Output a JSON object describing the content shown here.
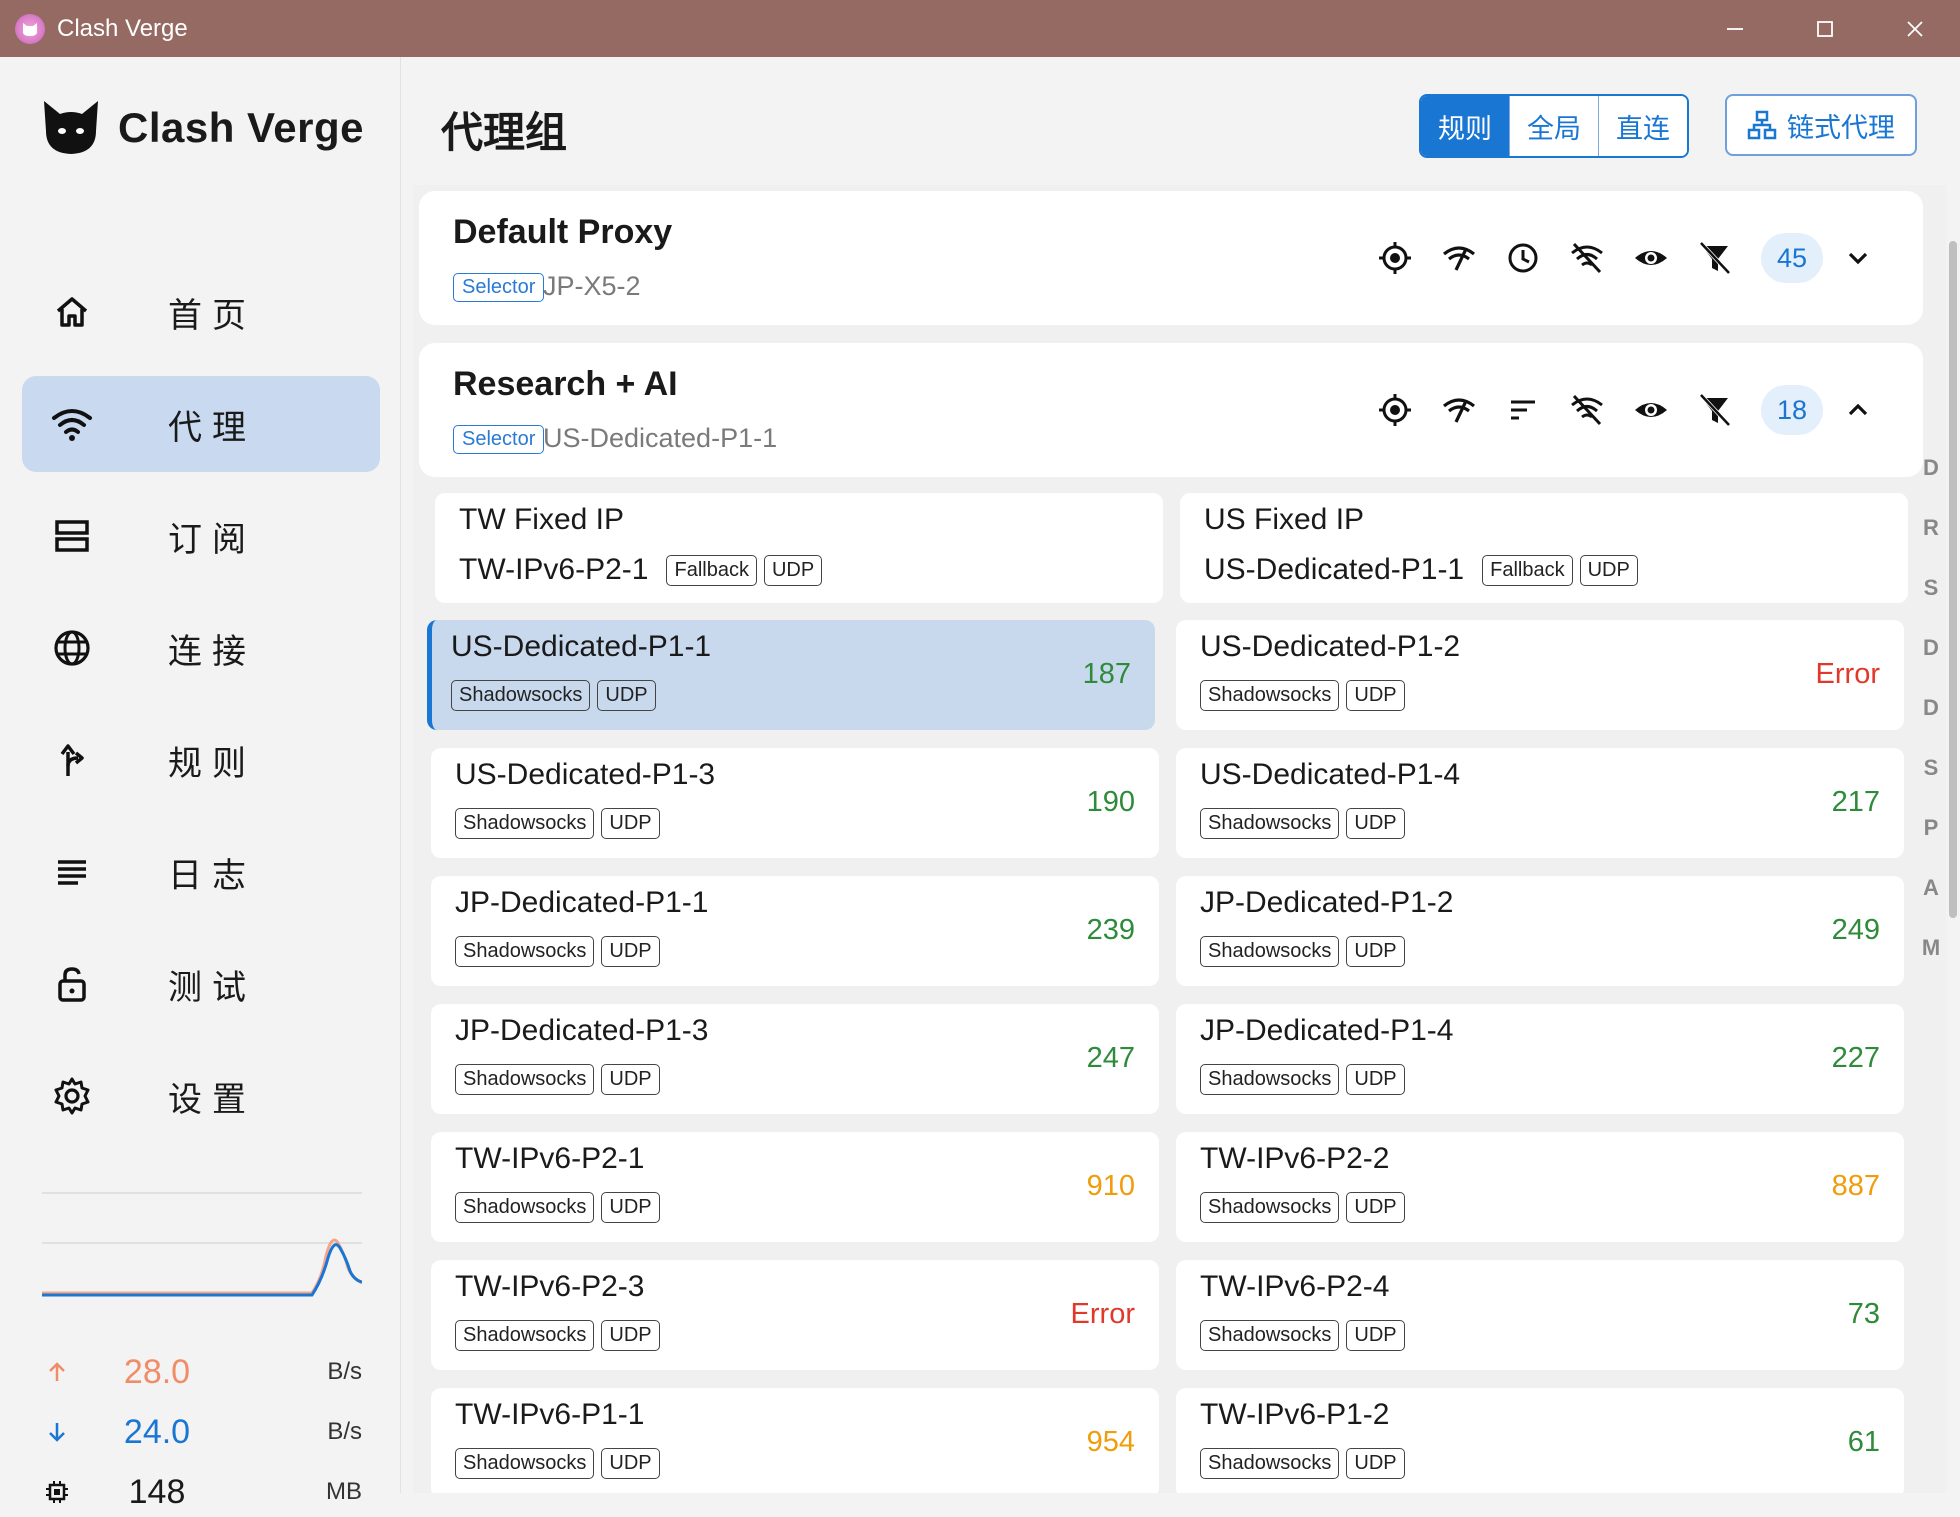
{
  "window": {
    "title": "Clash Verge"
  },
  "brand": {
    "name": "Clash Verge"
  },
  "nav": [
    {
      "label": "首页",
      "icon": "home-icon"
    },
    {
      "label": "代理",
      "icon": "wifi-icon"
    },
    {
      "label": "订阅",
      "icon": "storage-icon"
    },
    {
      "label": "连接",
      "icon": "globe-icon"
    },
    {
      "label": "规则",
      "icon": "fork-arrow-icon"
    },
    {
      "label": "日志",
      "icon": "list-icon"
    },
    {
      "label": "测试",
      "icon": "lock-icon"
    },
    {
      "label": "设置",
      "icon": "gear-icon"
    }
  ],
  "traffic": {
    "up": {
      "value": "28.0",
      "unit": "B/s",
      "color": "#f08c67"
    },
    "down": {
      "value": "24.0",
      "unit": "B/s",
      "color": "#1976d2"
    },
    "mem": {
      "value": "148",
      "unit": "MB"
    }
  },
  "header": {
    "title": "代理组",
    "modes": [
      "规则",
      "全局",
      "直连"
    ],
    "active_mode": "规则",
    "chain_label": "链式代理"
  },
  "groups": [
    {
      "name": "Default Proxy",
      "type": "Selector",
      "now": "JP-X5-2",
      "count": "45",
      "expanded": false
    },
    {
      "name": "Research + AI",
      "type": "Selector",
      "now": "US-Dedicated-P1-1",
      "count": "18",
      "expanded": true
    }
  ],
  "fallbacks": [
    {
      "title": "TW Fixed IP",
      "now": "TW-IPv6-P2-1",
      "tags": [
        "Fallback",
        "UDP"
      ]
    },
    {
      "title": "US Fixed IP",
      "now": "US-Dedicated-P1-1",
      "tags": [
        "Fallback",
        "UDP"
      ]
    }
  ],
  "proxies": [
    {
      "name": "US-Dedicated-P1-1",
      "delay": "187",
      "status": "green",
      "tags": [
        "Shadowsocks",
        "UDP"
      ],
      "selected": true
    },
    {
      "name": "US-Dedicated-P1-2",
      "delay": "Error",
      "status": "red",
      "tags": [
        "Shadowsocks",
        "UDP"
      ]
    },
    {
      "name": "US-Dedicated-P1-3",
      "delay": "190",
      "status": "green",
      "tags": [
        "Shadowsocks",
        "UDP"
      ]
    },
    {
      "name": "US-Dedicated-P1-4",
      "delay": "217",
      "status": "green",
      "tags": [
        "Shadowsocks",
        "UDP"
      ]
    },
    {
      "name": "JP-Dedicated-P1-1",
      "delay": "239",
      "status": "green",
      "tags": [
        "Shadowsocks",
        "UDP"
      ]
    },
    {
      "name": "JP-Dedicated-P1-2",
      "delay": "249",
      "status": "green",
      "tags": [
        "Shadowsocks",
        "UDP"
      ]
    },
    {
      "name": "JP-Dedicated-P1-3",
      "delay": "247",
      "status": "green",
      "tags": [
        "Shadowsocks",
        "UDP"
      ]
    },
    {
      "name": "JP-Dedicated-P1-4",
      "delay": "227",
      "status": "green",
      "tags": [
        "Shadowsocks",
        "UDP"
      ]
    },
    {
      "name": "TW-IPv6-P2-1",
      "delay": "910",
      "status": "orange",
      "tags": [
        "Shadowsocks",
        "UDP"
      ]
    },
    {
      "name": "TW-IPv6-P2-2",
      "delay": "887",
      "status": "orange",
      "tags": [
        "Shadowsocks",
        "UDP"
      ]
    },
    {
      "name": "TW-IPv6-P2-3",
      "delay": "Error",
      "status": "red",
      "tags": [
        "Shadowsocks",
        "UDP"
      ]
    },
    {
      "name": "TW-IPv6-P2-4",
      "delay": "73",
      "status": "green",
      "tags": [
        "Shadowsocks",
        "UDP"
      ]
    },
    {
      "name": "TW-IPv6-P1-1",
      "delay": "954",
      "status": "orange",
      "tags": [
        "Shadowsocks",
        "UDP"
      ]
    },
    {
      "name": "TW-IPv6-P1-2",
      "delay": "61",
      "status": "green",
      "tags": [
        "Shadowsocks",
        "UDP"
      ]
    }
  ],
  "letter_index": [
    "D",
    "R",
    "S",
    "D",
    "D",
    "S",
    "P",
    "A",
    "M"
  ]
}
